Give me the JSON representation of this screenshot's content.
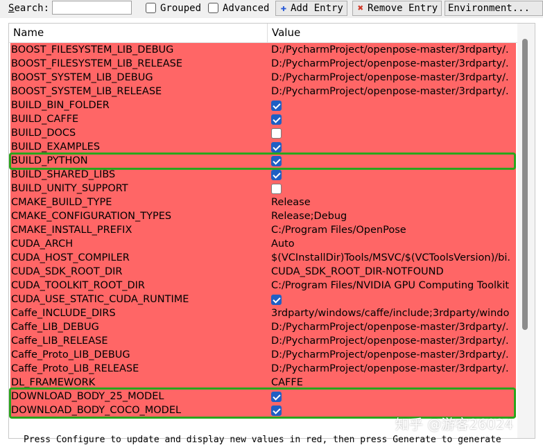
{
  "toolbar": {
    "search_label": "Search:",
    "search_value": "",
    "grouped_label": "Grouped",
    "advanced_label": "Advanced",
    "add_entry_label": "Add Entry",
    "remove_entry_label": "Remove Entry",
    "environment_label": "Environment..."
  },
  "table": {
    "columns": {
      "name": "Name",
      "value": "Value"
    },
    "rows": [
      {
        "name": "BOOST_FILESYSTEM_LIB_DEBUG",
        "type": "text",
        "value": "D:/PycharmProject/openpose-master/3rdparty/."
      },
      {
        "name": "BOOST_FILESYSTEM_LIB_RELEASE",
        "type": "text",
        "value": "D:/PycharmProject/openpose-master/3rdparty/."
      },
      {
        "name": "BOOST_SYSTEM_LIB_DEBUG",
        "type": "text",
        "value": "D:/PycharmProject/openpose-master/3rdparty/."
      },
      {
        "name": "BOOST_SYSTEM_LIB_RELEASE",
        "type": "text",
        "value": "D:/PycharmProject/openpose-master/3rdparty/."
      },
      {
        "name": "BUILD_BIN_FOLDER",
        "type": "bool",
        "checked": true
      },
      {
        "name": "BUILD_CAFFE",
        "type": "bool",
        "checked": true
      },
      {
        "name": "BUILD_DOCS",
        "type": "bool",
        "checked": false
      },
      {
        "name": "BUILD_EXAMPLES",
        "type": "bool",
        "checked": true
      },
      {
        "name": "BUILD_PYTHON",
        "type": "bool",
        "checked": true
      },
      {
        "name": "BUILD_SHARED_LIBS",
        "type": "bool",
        "checked": true
      },
      {
        "name": "BUILD_UNITY_SUPPORT",
        "type": "bool",
        "checked": false
      },
      {
        "name": "CMAKE_BUILD_TYPE",
        "type": "text",
        "value": "Release"
      },
      {
        "name": "CMAKE_CONFIGURATION_TYPES",
        "type": "text",
        "value": "Release;Debug"
      },
      {
        "name": "CMAKE_INSTALL_PREFIX",
        "type": "text",
        "value": "C:/Program Files/OpenPose"
      },
      {
        "name": "CUDA_ARCH",
        "type": "text",
        "value": "Auto"
      },
      {
        "name": "CUDA_HOST_COMPILER",
        "type": "text",
        "value": "$(VCInstallDir)Tools/MSVC/$(VCToolsVersion)/bi."
      },
      {
        "name": "CUDA_SDK_ROOT_DIR",
        "type": "text",
        "value": "CUDA_SDK_ROOT_DIR-NOTFOUND"
      },
      {
        "name": "CUDA_TOOLKIT_ROOT_DIR",
        "type": "text",
        "value": "C:/Program Files/NVIDIA GPU Computing Toolkit"
      },
      {
        "name": "CUDA_USE_STATIC_CUDA_RUNTIME",
        "type": "bool",
        "checked": true
      },
      {
        "name": "Caffe_INCLUDE_DIRS",
        "type": "text",
        "value": "3rdparty/windows/caffe/include;3rdparty/windo"
      },
      {
        "name": "Caffe_LIB_DEBUG",
        "type": "text",
        "value": "D:/PycharmProject/openpose-master/3rdparty/."
      },
      {
        "name": "Caffe_LIB_RELEASE",
        "type": "text",
        "value": "D:/PycharmProject/openpose-master/3rdparty/."
      },
      {
        "name": "Caffe_Proto_LIB_DEBUG",
        "type": "text",
        "value": "D:/PycharmProject/openpose-master/3rdparty/."
      },
      {
        "name": "Caffe_Proto_LIB_RELEASE",
        "type": "text",
        "value": "D:/PycharmProject/openpose-master/3rdparty/."
      },
      {
        "name": "DL_FRAMEWORK",
        "type": "text",
        "value": "CAFFE"
      },
      {
        "name": "DOWNLOAD_BODY_25_MODEL",
        "type": "bool",
        "checked": true
      },
      {
        "name": "DOWNLOAD_BODY_COCO_MODEL",
        "type": "bool",
        "checked": true
      }
    ]
  },
  "watermark": "知乎 @游客26024",
  "status_text": "Press Configure to update and display new values in red, then press Generate to generate",
  "colors": {
    "new_row_bg": "#ff6666",
    "highlight_border": "#2aa51c",
    "checkbox_checked": "#1f5fc4"
  }
}
